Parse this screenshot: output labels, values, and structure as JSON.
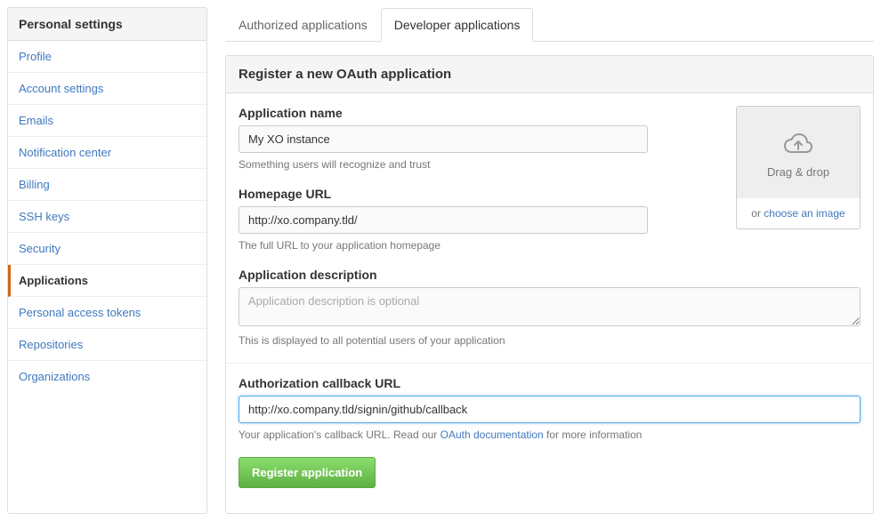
{
  "sidebar": {
    "header": "Personal settings",
    "items": [
      {
        "label": "Profile",
        "active": false
      },
      {
        "label": "Account settings",
        "active": false
      },
      {
        "label": "Emails",
        "active": false
      },
      {
        "label": "Notification center",
        "active": false
      },
      {
        "label": "Billing",
        "active": false
      },
      {
        "label": "SSH keys",
        "active": false
      },
      {
        "label": "Security",
        "active": false
      },
      {
        "label": "Applications",
        "active": true
      },
      {
        "label": "Personal access tokens",
        "active": false
      },
      {
        "label": "Repositories",
        "active": false
      },
      {
        "label": "Organizations",
        "active": false
      }
    ]
  },
  "tabs": [
    {
      "label": "Authorized applications",
      "active": false
    },
    {
      "label": "Developer applications",
      "active": true
    }
  ],
  "panel": {
    "title": "Register a new OAuth application"
  },
  "form": {
    "app_name": {
      "label": "Application name",
      "value": "My XO instance",
      "hint": "Something users will recognize and trust"
    },
    "homepage": {
      "label": "Homepage URL",
      "value": "http://xo.company.tld/",
      "hint": "The full URL to your application homepage"
    },
    "description": {
      "label": "Application description",
      "placeholder": "Application description is optional",
      "value": "",
      "hint": "This is displayed to all potential users of your application"
    },
    "callback": {
      "label": "Authorization callback URL",
      "value": "http://xo.company.tld/signin/github/callback",
      "hint_pre": "Your application's callback URL. Read our ",
      "hint_link": "OAuth documentation",
      "hint_post": " for more information"
    },
    "submit_label": "Register application"
  },
  "uploader": {
    "drop_label": "Drag & drop",
    "or": "or ",
    "choose_label": "choose an image"
  }
}
